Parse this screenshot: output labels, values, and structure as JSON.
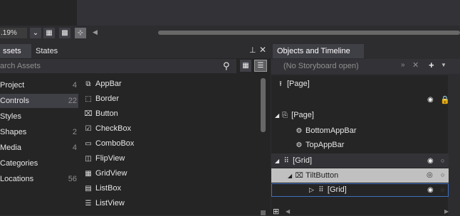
{
  "toolbar": {
    "zoom_value": ".19%",
    "zoom_dropdown_icon": "chevron-down-icon",
    "grid_toggle_icon": "grid-icon",
    "snap_toggle_icon": "snap-grid-icon",
    "snap_lines_icon": "snap-lines-icon"
  },
  "left_panel": {
    "tabs": [
      {
        "label": "ssets",
        "active": true
      },
      {
        "label": "States",
        "active": false
      }
    ],
    "search_placeholder": "arch Assets",
    "categories": [
      {
        "label": "Project",
        "count": "4"
      },
      {
        "label": "Controls",
        "count": "22",
        "selected": true
      },
      {
        "label": "Styles",
        "count": ""
      },
      {
        "label": "Shapes",
        "count": "2"
      },
      {
        "label": "Media",
        "count": "4"
      },
      {
        "label": "Categories",
        "count": ""
      },
      {
        "label": "Locations",
        "count": "56"
      }
    ],
    "assets": [
      {
        "label": "AppBar",
        "icon": "appbar-icon"
      },
      {
        "label": "Border",
        "icon": "border-icon"
      },
      {
        "label": "Button",
        "icon": "button-icon"
      },
      {
        "label": "CheckBox",
        "icon": "checkbox-icon"
      },
      {
        "label": "ComboBox",
        "icon": "combobox-icon"
      },
      {
        "label": "FlipView",
        "icon": "flipview-icon"
      },
      {
        "label": "GridView",
        "icon": "gridview-icon"
      },
      {
        "label": "ListBox",
        "icon": "listbox-icon"
      },
      {
        "label": "ListView",
        "icon": "listview-icon"
      }
    ]
  },
  "right_panel": {
    "title": "Objects and Timeline",
    "storyboard": "(No Storyboard open)",
    "tree": [
      {
        "label": "[Page]",
        "icon": "scope-up-icon",
        "depth": 0
      },
      {
        "label": "[Page]",
        "icon": "page-icon",
        "depth": 0,
        "expanded": true
      },
      {
        "label": "BottomAppBar",
        "icon": "appbar-icon",
        "depth": 1
      },
      {
        "label": "TopAppBar",
        "icon": "appbar-icon",
        "depth": 1
      },
      {
        "label": "[Grid]",
        "icon": "grid-icon",
        "depth": 1,
        "expanded": true
      },
      {
        "label": "TiltButton",
        "icon": "button-icon",
        "depth": 2,
        "expanded": true,
        "selected": true
      },
      {
        "label": "[Grid]",
        "icon": "grid-icon",
        "depth": 3,
        "expanded": false,
        "focused": true
      }
    ]
  },
  "colors": {
    "panel_bg": "#252526",
    "chrome_bg": "#2d2d30",
    "selected_row": "#c0c0c0",
    "focus_border": "#3f6ebf"
  }
}
